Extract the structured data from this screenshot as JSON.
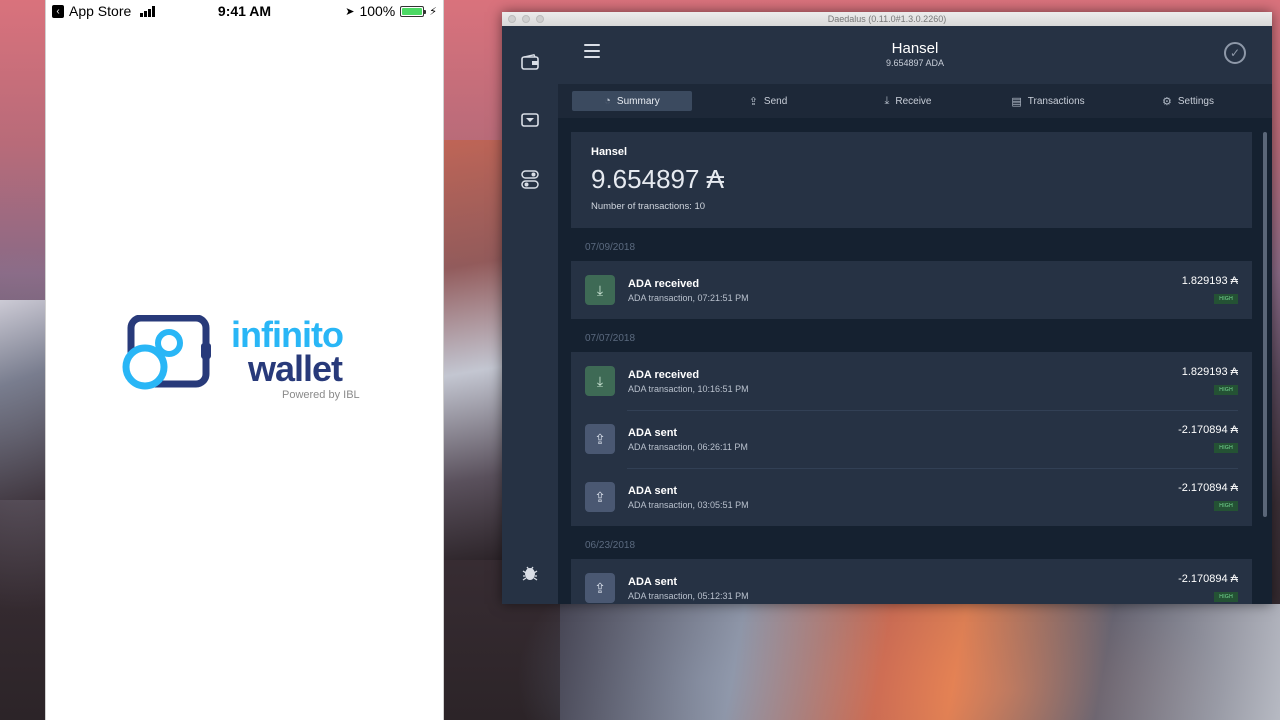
{
  "status_bar": {
    "carrier": "App Store",
    "time": "9:41 AM",
    "battery": "100%",
    "battery_level": 1.0
  },
  "phone_logo": {
    "line1": "infinito",
    "line2": "wallet",
    "line3": "Powered by IBL"
  },
  "window": {
    "title": "Daedalus (0.11.0#1.3.0.2260)"
  },
  "header": {
    "wallet_name": "Hansel",
    "wallet_balance": "9.654897 ADA"
  },
  "tabs": [
    {
      "label": "Summary",
      "icon": "summary-icon",
      "active": true
    },
    {
      "label": "Send",
      "icon": "send-icon",
      "active": false
    },
    {
      "label": "Receive",
      "icon": "receive-icon",
      "active": false
    },
    {
      "label": "Transactions",
      "icon": "transactions-icon",
      "active": false
    },
    {
      "label": "Settings",
      "icon": "settings-icon",
      "active": false
    }
  ],
  "summary": {
    "name": "Hansel",
    "amount": "9.654897 ₳",
    "tx_count": "Number of transactions: 10"
  },
  "groups": [
    {
      "date": "07/09/2018",
      "transactions": [
        {
          "type": "recv",
          "title": "ADA received",
          "subtitle": "ADA transaction, 07:21:51 PM",
          "amount": "1.829193 ₳",
          "badge": "HIGH"
        }
      ]
    },
    {
      "date": "07/07/2018",
      "transactions": [
        {
          "type": "recv",
          "title": "ADA received",
          "subtitle": "ADA transaction, 10:16:51 PM",
          "amount": "1.829193 ₳",
          "badge": "HIGH"
        },
        {
          "type": "sent",
          "title": "ADA sent",
          "subtitle": "ADA transaction, 06:26:11 PM",
          "amount": "-2.170894 ₳",
          "badge": "HIGH"
        },
        {
          "type": "sent",
          "title": "ADA sent",
          "subtitle": "ADA transaction, 03:05:51 PM",
          "amount": "-2.170894 ₳",
          "badge": "HIGH"
        }
      ]
    },
    {
      "date": "06/23/2018",
      "transactions": [
        {
          "type": "sent",
          "title": "ADA sent",
          "subtitle": "ADA transaction, 05:12:31 PM",
          "amount": "-2.170894 ₳",
          "badge": "HIGH"
        }
      ]
    }
  ]
}
